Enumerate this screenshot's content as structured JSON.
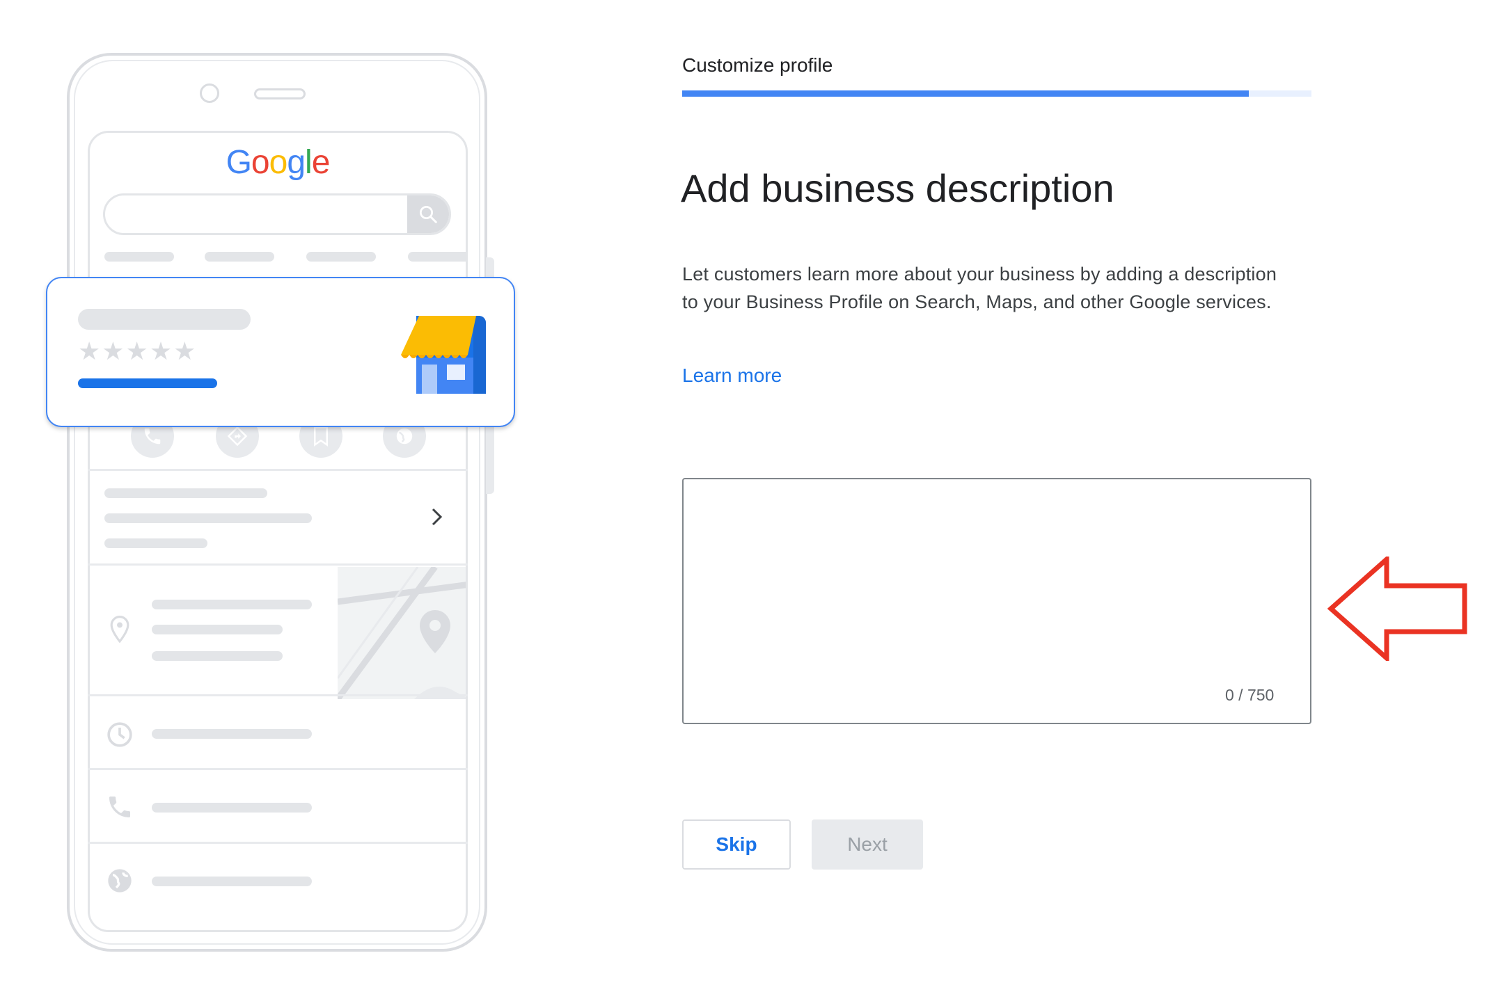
{
  "step": {
    "title": "Customize profile",
    "progress_percent": 90
  },
  "main": {
    "heading": "Add business description",
    "description": "Let customers learn more about your business by adding a description to your Business Profile on Search, Maps, and other Google services.",
    "learn_more": "Learn more",
    "textarea_value": "",
    "char_counter": "0 / 750"
  },
  "buttons": {
    "skip": "Skip",
    "next": "Next"
  },
  "illustration": {
    "logo_letters": [
      "G",
      "o",
      "o",
      "g",
      "l",
      "e"
    ],
    "logo_colors": [
      "#4285f4",
      "#ea4335",
      "#fbbc05",
      "#4285f4",
      "#34a853",
      "#ea4335"
    ],
    "rating_stars_filled": 0,
    "rating_stars_total": 5,
    "stars_text": "★★★★★",
    "icons": [
      "search-icon",
      "store-icon",
      "phone-icon",
      "directions-icon",
      "bookmark-icon",
      "globe-icon",
      "chevron-right-icon",
      "location-pin-icon",
      "map-pin-icon",
      "clock-icon",
      "globe-icon"
    ]
  },
  "colors": {
    "accent": "#1a73e8",
    "progress": "#4285f4",
    "annotation_arrow": "#ea3323"
  }
}
